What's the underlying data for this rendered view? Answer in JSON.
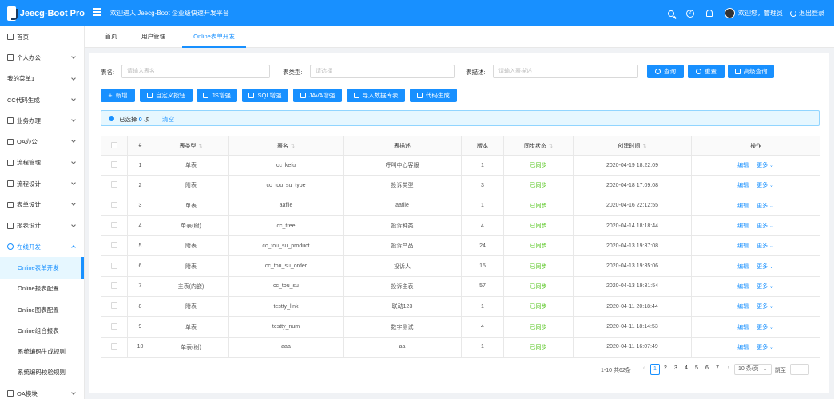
{
  "header": {
    "app_name": "Jeecg-Boot Pro",
    "welcome": "欢迎进入 Jeecg-Boot 企业级快速开发平台",
    "user_greeting": "欢迎您，管理员",
    "logout": "退出登录"
  },
  "sidebar": {
    "items": [
      {
        "label": "首页"
      },
      {
        "label": "个人办公"
      },
      {
        "label": "我的菜单1"
      },
      {
        "label": "CC代码生成"
      },
      {
        "label": "业务办理"
      },
      {
        "label": "OA办公"
      },
      {
        "label": "流程管理"
      },
      {
        "label": "流程设计"
      },
      {
        "label": "表单设计"
      },
      {
        "label": "报表设计"
      },
      {
        "label": "在线开发"
      },
      {
        "label": "Online表单开发"
      },
      {
        "label": "Online报表配置"
      },
      {
        "label": "Online图表配置"
      },
      {
        "label": "Online组合报表"
      },
      {
        "label": "系统编码生成规则"
      },
      {
        "label": "系统编码校验规则"
      },
      {
        "label": "OA模块"
      }
    ]
  },
  "tabs": [
    {
      "label": "首页"
    },
    {
      "label": "用户管理"
    },
    {
      "label": "Online表单开发"
    }
  ],
  "search": {
    "table_name_label": "表名:",
    "table_name_placeholder": "请输入表名",
    "table_type_label": "表类型:",
    "table_type_placeholder": "请选择",
    "table_desc_label": "表描述:",
    "table_desc_placeholder": "请输入表描述",
    "query_btn": "查询",
    "reset_btn": "重置",
    "advanced_btn": "高级查询"
  },
  "toolbar": {
    "add": "新增",
    "custom_btn": "自定义按钮",
    "js": "JS增强",
    "sql": "SQL增强",
    "java": "JAVA增强",
    "import_db": "导入数据库表",
    "codegen": "代码生成"
  },
  "selection": {
    "prefix": "已选择",
    "count": "0",
    "suffix": "项",
    "clear": "清空"
  },
  "table": {
    "headers": [
      "#",
      "表类型",
      "表名",
      "表描述",
      "版本",
      "同步状态",
      "创建时间",
      "操作"
    ],
    "edit_label": "编辑",
    "more_label": "更多",
    "rows": [
      {
        "no": "1",
        "type": "单表",
        "name": "cc_kefu",
        "desc": "呼叫中心客服",
        "ver": "1",
        "status": "已同步",
        "time": "2020-04-19 18:22:09"
      },
      {
        "no": "2",
        "type": "附表",
        "name": "cc_tou_su_type",
        "desc": "投诉类型",
        "ver": "3",
        "status": "已同步",
        "time": "2020-04-18 17:09:08"
      },
      {
        "no": "3",
        "type": "单表",
        "name": "aafile",
        "desc": "aafile",
        "ver": "1",
        "status": "已同步",
        "time": "2020-04-16 22:12:55"
      },
      {
        "no": "4",
        "type": "单表(树)",
        "name": "cc_tree",
        "desc": "投诉种类",
        "ver": "4",
        "status": "已同步",
        "time": "2020-04-14 18:18:44"
      },
      {
        "no": "5",
        "type": "附表",
        "name": "cc_tou_su_product",
        "desc": "投诉产品",
        "ver": "24",
        "status": "已同步",
        "time": "2020-04-13 19:37:08"
      },
      {
        "no": "6",
        "type": "附表",
        "name": "cc_tou_su_order",
        "desc": "投诉人",
        "ver": "15",
        "status": "已同步",
        "time": "2020-04-13 19:35:06"
      },
      {
        "no": "7",
        "type": "主表(内嵌)",
        "name": "cc_tou_su",
        "desc": "投诉主表",
        "ver": "57",
        "status": "已同步",
        "time": "2020-04-13 19:31:54"
      },
      {
        "no": "8",
        "type": "附表",
        "name": "testty_link",
        "desc": "联动123",
        "ver": "1",
        "status": "已同步",
        "time": "2020-04-11 20:18:44"
      },
      {
        "no": "9",
        "type": "单表",
        "name": "testty_num",
        "desc": "数字测试",
        "ver": "4",
        "status": "已同步",
        "time": "2020-04-11 18:14:53"
      },
      {
        "no": "10",
        "type": "单表(树)",
        "name": "aaa",
        "desc": "aa",
        "ver": "1",
        "status": "已同步",
        "time": "2020-04-11 16:07:49"
      }
    ]
  },
  "pagination": {
    "total": "1-10 共62条",
    "pages": [
      "1",
      "2",
      "3",
      "4",
      "5",
      "6",
      "7"
    ],
    "current": "1",
    "page_size": "10 条/页",
    "jump_label": "跳至"
  },
  "colors": {
    "primary": "#1890ff",
    "success": "#52c41a"
  }
}
